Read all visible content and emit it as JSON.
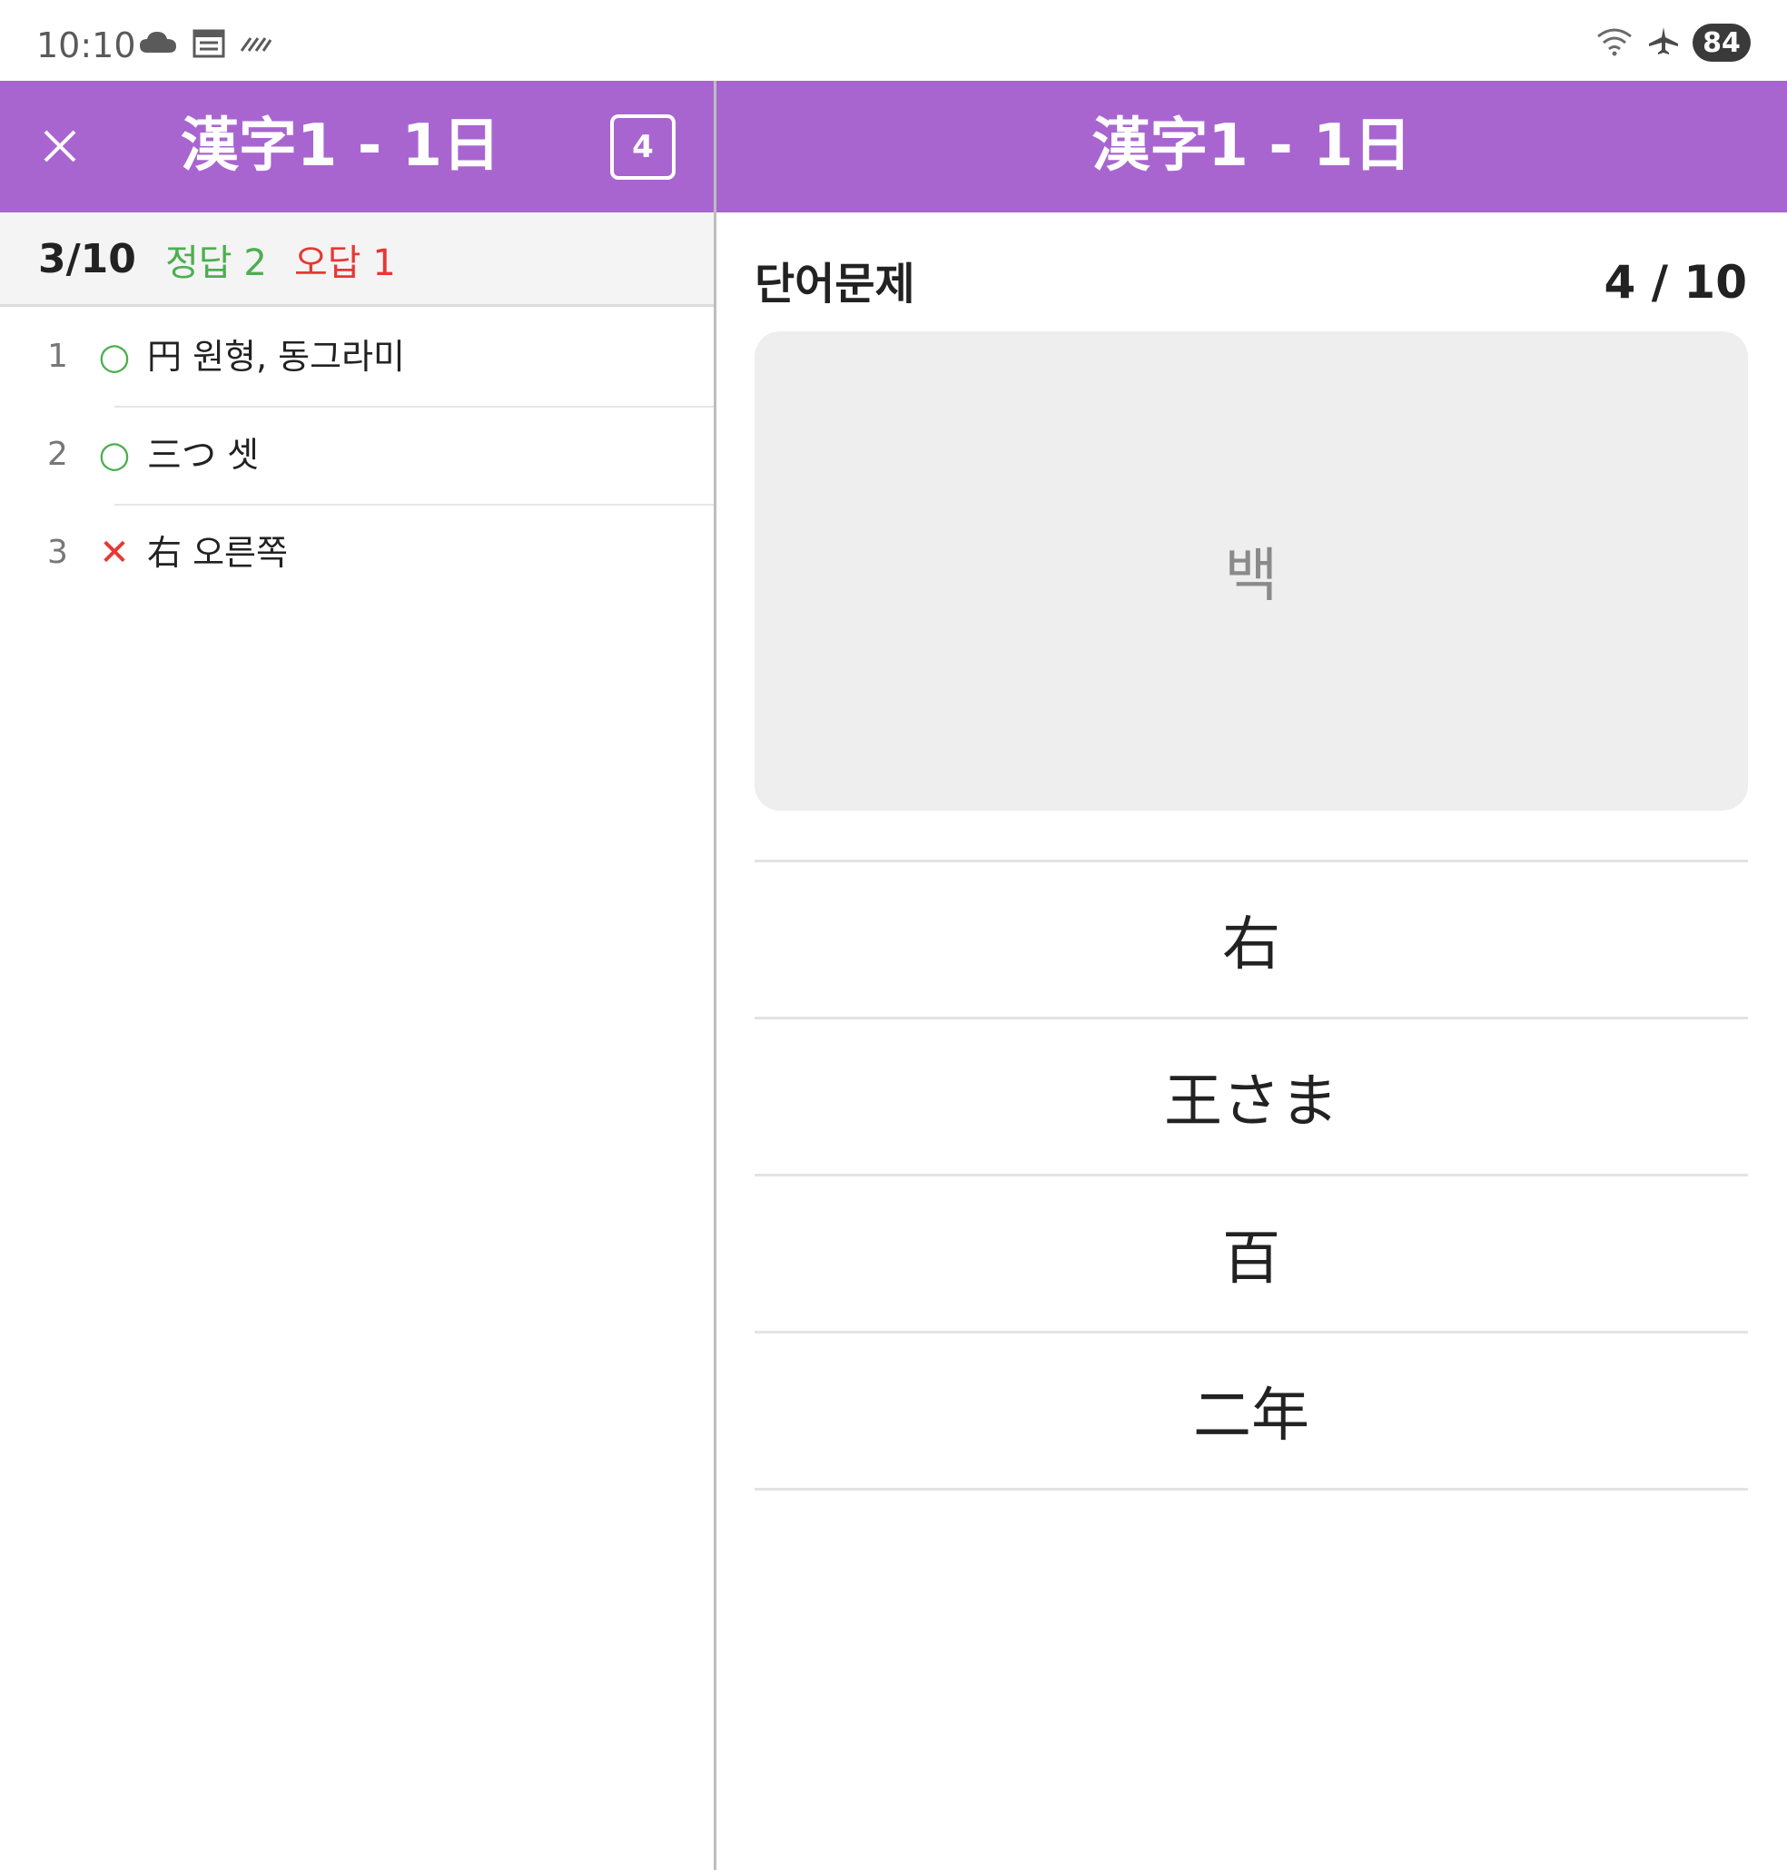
{
  "status_bar": {
    "time": "10:10",
    "battery": "84",
    "left_icons": [
      "cloud-icon",
      "calendar-icon",
      "sync-stripes-icon"
    ],
    "right_icons": [
      "wifi-icon",
      "airplane-icon"
    ]
  },
  "left_panel": {
    "title": "漢字1 - 1日",
    "count_badge": "4",
    "score": {
      "progress": "3/10",
      "correct": "정답 2",
      "wrong": "오답 1"
    },
    "history": [
      {
        "num": "1",
        "mark": "○",
        "result": "correct",
        "text": "円 원형, 동그라미"
      },
      {
        "num": "2",
        "mark": "○",
        "result": "correct",
        "text": "三つ 셋"
      },
      {
        "num": "3",
        "mark": "✕",
        "result": "wrong",
        "text": "右 오른쪽"
      }
    ]
  },
  "right_panel": {
    "title": "漢字1 - 1日",
    "question_label": "단어문제",
    "counter": "4 / 10",
    "question_word": "백",
    "options": [
      "右",
      "王さま",
      "百",
      "二年"
    ]
  },
  "colors": {
    "app_bar": "#a865d0",
    "correct": "#4caf50",
    "wrong": "#e53935",
    "card_bg": "#eeeeee"
  }
}
